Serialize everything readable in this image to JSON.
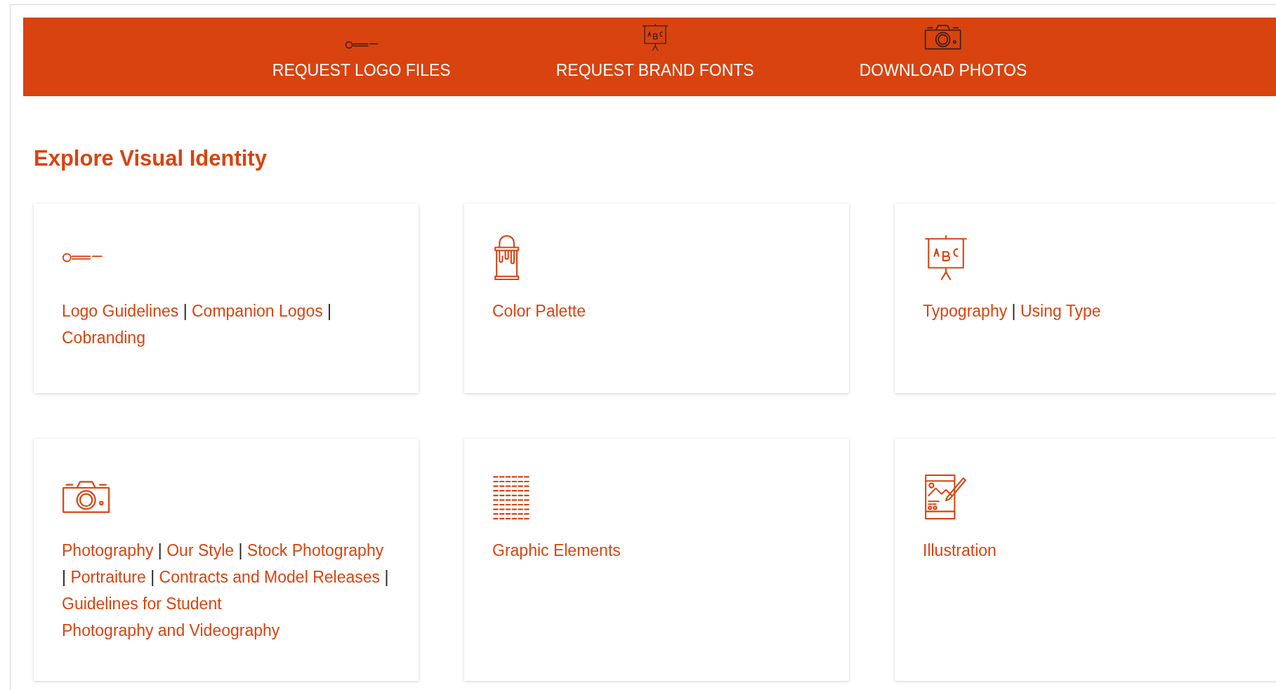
{
  "nav": [
    {
      "kind": "logo",
      "label": "REQUEST LOGO FILES"
    },
    {
      "kind": "board",
      "label": "REQUEST BRAND FONTS"
    },
    {
      "kind": "camera",
      "label": "DOWNLOAD PHOTOS"
    }
  ],
  "heading": "Explore Visual Identity",
  "cards": [
    {
      "kind": "logo",
      "items": [
        {
          "kind": "link",
          "text": "Logo Guidelines"
        },
        {
          "kind": "separator",
          "text": "|"
        },
        {
          "kind": "link",
          "text": "Companion Logos"
        },
        {
          "kind": "separator",
          "text": "|"
        },
        {
          "kind": "link",
          "text": "Cobranding"
        }
      ]
    },
    {
      "kind": "bucket",
      "items": [
        {
          "kind": "link",
          "text": "Color Palette"
        }
      ]
    },
    {
      "kind": "board",
      "items": [
        {
          "kind": "link",
          "text": "Typography"
        },
        {
          "kind": "separator",
          "text": "|"
        },
        {
          "kind": "link",
          "text": "Using Type"
        }
      ]
    },
    {
      "kind": "camera",
      "items": [
        {
          "kind": "link",
          "text": "Photography"
        },
        {
          "kind": "separator",
          "text": "|"
        },
        {
          "kind": "link",
          "text": "Our Style"
        },
        {
          "kind": "separator",
          "text": "|"
        },
        {
          "kind": "link",
          "text": "Stock Photography"
        },
        {
          "kind": "separator",
          "text": "|"
        },
        {
          "kind": "link",
          "text": "Portraiture"
        },
        {
          "kind": "separator",
          "text": "|"
        },
        {
          "kind": "link",
          "text": "Contracts and Model Releases"
        },
        {
          "kind": "separator",
          "text": "|"
        },
        {
          "kind": "link",
          "text": "Guidelines for Student"
        },
        {
          "kind": "link",
          "text": "Photography and Videography"
        }
      ]
    },
    {
      "kind": "pattern",
      "items": [
        {
          "kind": "link",
          "text": "Graphic Elements"
        }
      ]
    },
    {
      "kind": "illustration",
      "items": [
        {
          "kind": "link",
          "text": "Illustration"
        }
      ]
    }
  ]
}
